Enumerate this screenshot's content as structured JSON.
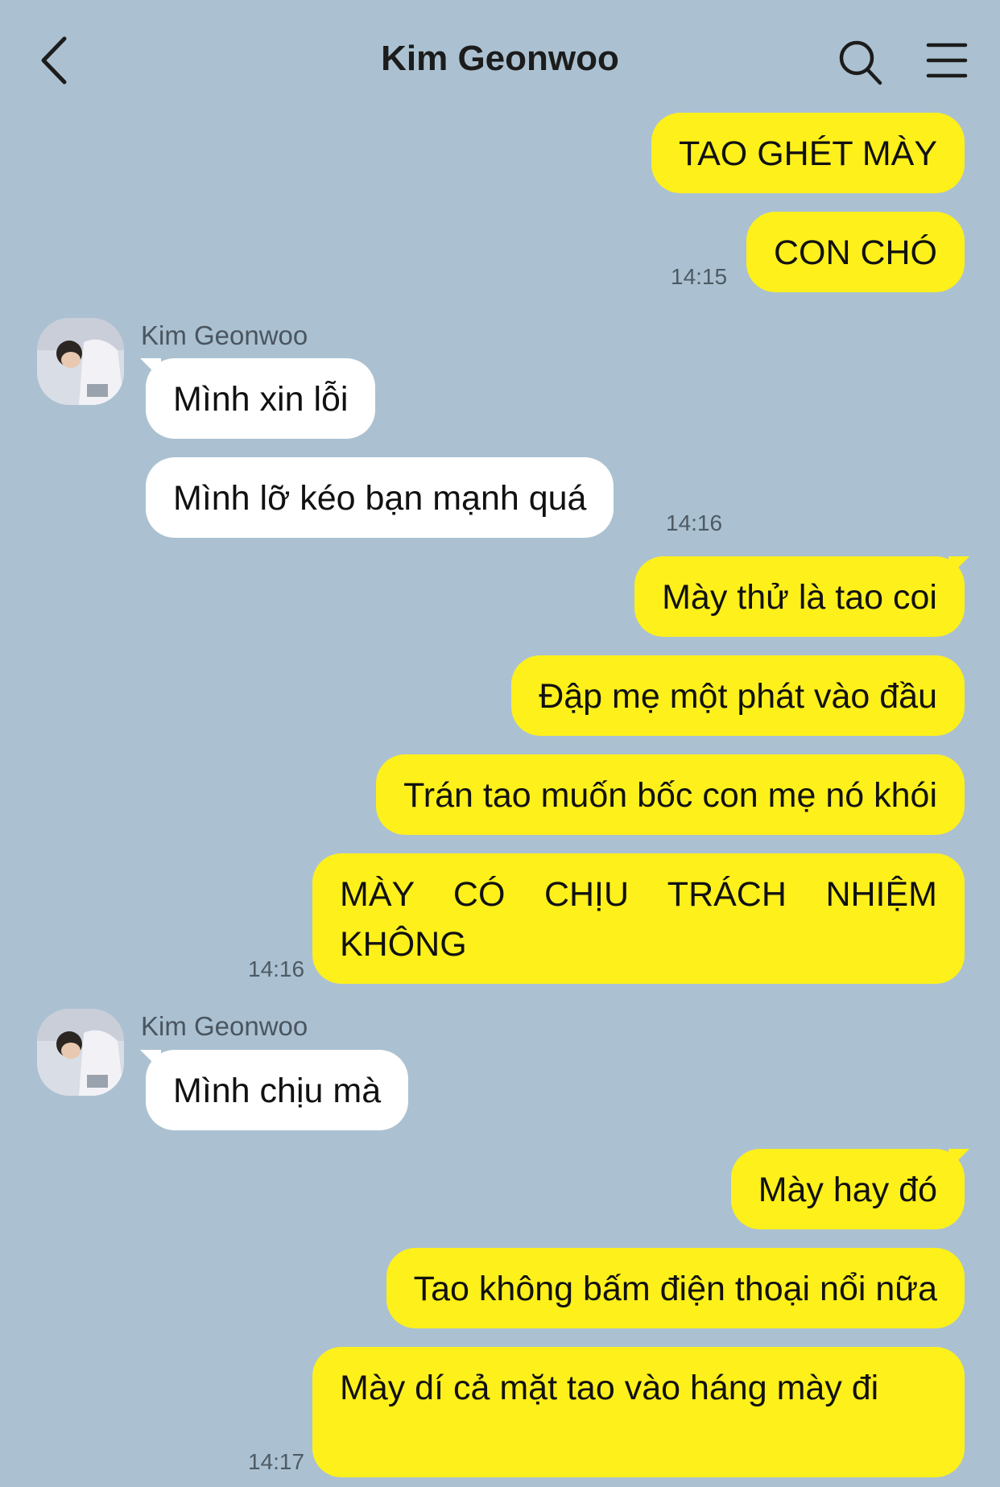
{
  "header": {
    "title": "Kim Geonwoo",
    "back_icon": "chevron-left-icon",
    "search_icon": "search-icon",
    "menu_icon": "hamburger-menu-icon"
  },
  "colors": {
    "background": "#abc1d1",
    "my_bubble": "#fef01b",
    "their_bubble": "#ffffff"
  },
  "messages": [
    {
      "from": "me",
      "text": "TAO GHÉT MÀY"
    },
    {
      "from": "me",
      "text": "CON CHÓ",
      "time": "14:15"
    },
    {
      "from": "them",
      "sender": "Kim Geonwoo",
      "text": "Mình xin lỗi"
    },
    {
      "from": "them",
      "text": "Mình lỡ kéo bạn mạnh quá",
      "time": "14:16"
    },
    {
      "from": "me",
      "text": "Mày thử là tao coi"
    },
    {
      "from": "me",
      "text": "Đập mẹ một phát vào đầu"
    },
    {
      "from": "me",
      "text": "Trán tao muốn bốc con mẹ nó khói"
    },
    {
      "from": "me",
      "text": "MÀY CÓ CHỊU TRÁCH NHIỆM KHÔNG",
      "time": "14:16"
    },
    {
      "from": "them",
      "sender": "Kim Geonwoo",
      "text": "Mình chịu mà"
    },
    {
      "from": "me",
      "text": "Mày hay đó"
    },
    {
      "from": "me",
      "text": "Tao không bấm điện thoại nổi nữa"
    },
    {
      "from": "me",
      "text": "Mày dí cả mặt tao vào háng mày đi",
      "time": "14:17"
    }
  ]
}
